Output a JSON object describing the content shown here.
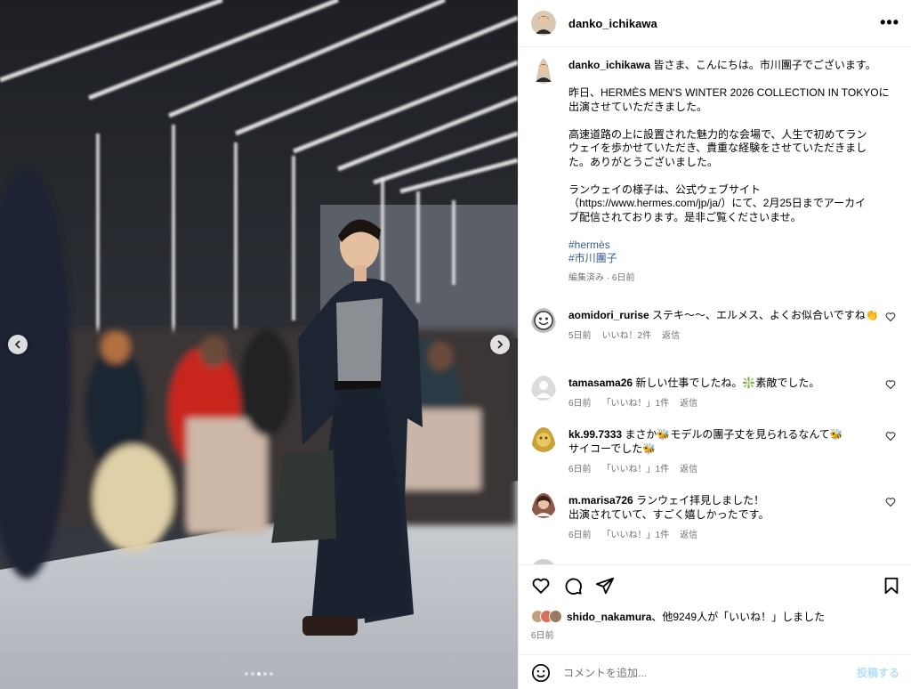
{
  "post": {
    "author": "danko_ichikawa",
    "more_icon": "more-horizontal-icon",
    "caption": {
      "author": "danko_ichikawa",
      "greeting": "皆さま、こんにちは。市川團子でございます。",
      "paragraph1": "昨日、HERMÈS MEN'S WINTER 2026 COLLECTION IN TOKYOに\n出演させていただきました。",
      "paragraph2": "高速道路の上に設置された魅力的な会場で、人生で初めてラン\nウェイを歩かせていただき、貴重な経験をさせていただきまし\nた。ありがとうございました。",
      "paragraph3": "ランウェイの様子は、公式ウェブサイト\n（https://www.hermes.com/jp/ja/）にて、2月25日までアーカイ\nブ配信されております。是非ご覧くださいませ。",
      "hashtags": [
        "#hermès",
        "#市川團子"
      ],
      "meta": "編集済み · 6日前"
    },
    "carousel": {
      "total": 5,
      "active": 2
    }
  },
  "comments": [
    {
      "user": "aomidori_rurise",
      "text": "ステキ〜〜、エルメス、よくお似合いですね👏",
      "time": "5日前",
      "likes": "いいね！2件",
      "reply": "返信",
      "avatar_color": "#bfbfbf"
    },
    {
      "user": "tamasama26",
      "text": "新しい仕事でしたね。❇️素敵でした。",
      "time": "6日前",
      "likes": "「いいね！」1件",
      "reply": "返信",
      "avatar_color": "#dbdbdb"
    },
    {
      "user": "kk.99.7333",
      "text": "まさか🐝モデルの團子丈を見られるなんて🐝\nサイコーでした🐝",
      "time": "6日前",
      "likes": "「いいね！」1件",
      "reply": "返信",
      "avatar_color": "#c9a23a"
    },
    {
      "user": "m.marisa726",
      "text": "ランウェイ拝見しました！\n出演されていて、すごく嬉しかったです。",
      "time": "6日前",
      "likes": "「いいね！」1件",
      "reply": "返信",
      "avatar_color": "#8a5a4a"
    }
  ],
  "actions": {
    "like_icon": "heart-icon",
    "comment_icon": "comment-icon",
    "share_icon": "send-icon",
    "save_icon": "bookmark-icon"
  },
  "likes": {
    "user": "shido_nakamura",
    "text": "、他9249人が「いいね！」しました",
    "date": "6日前"
  },
  "add_comment": {
    "placeholder": "コメントを追加...",
    "post_label": "投稿する",
    "post_color": "#b2dffc"
  }
}
